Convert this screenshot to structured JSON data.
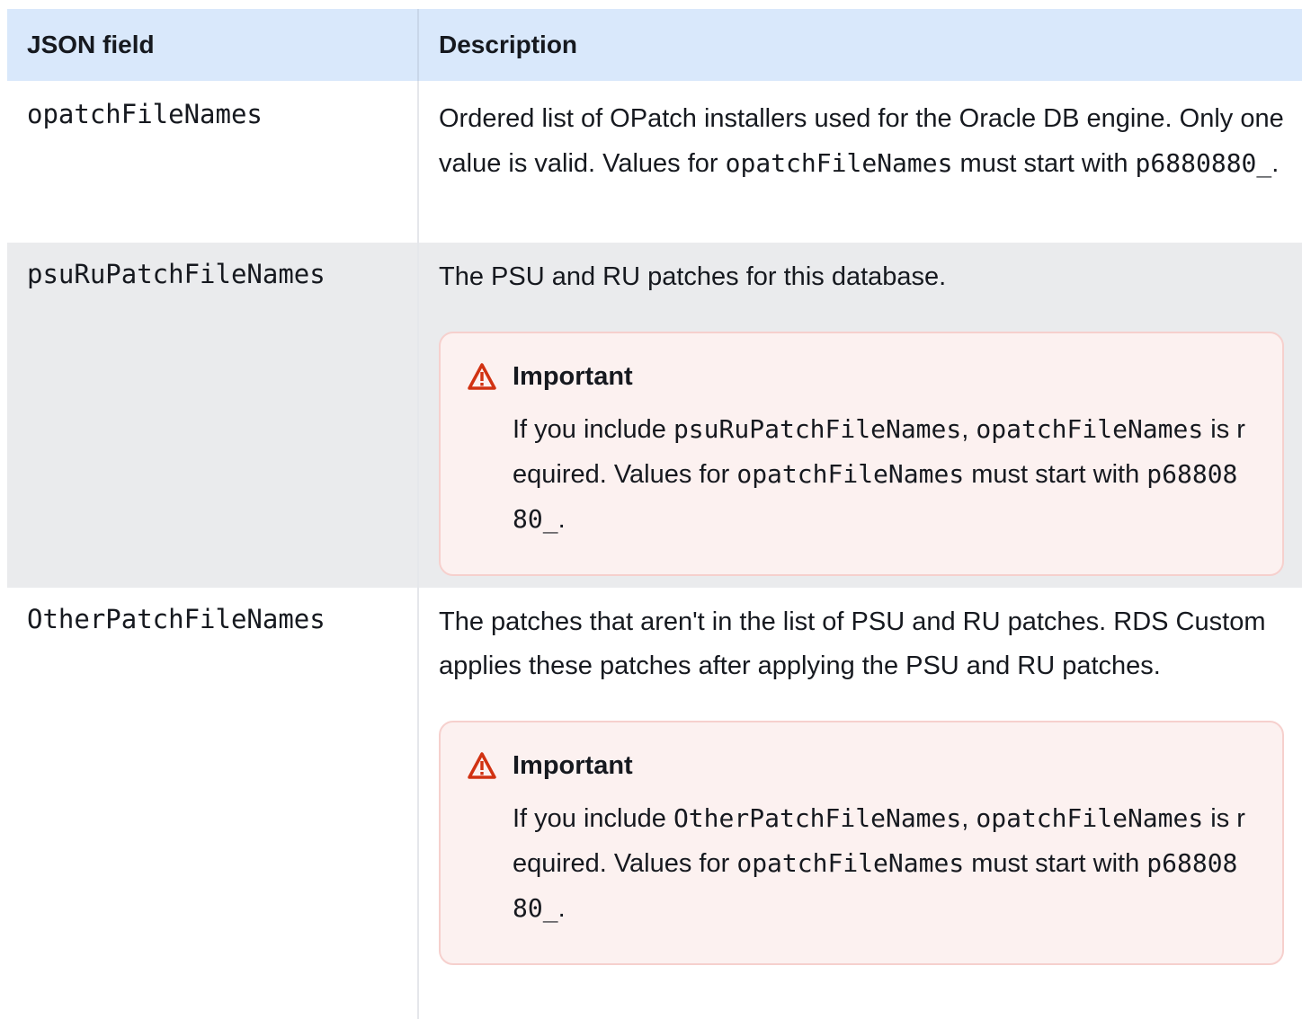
{
  "header": {
    "col_field": "JSON field",
    "col_desc": "Description"
  },
  "rows": [
    {
      "field": "opatchFileNames",
      "desc_part1": "Ordered list of OPatch installers used for the Oracle DB engine. Only one value is valid. Values for ",
      "desc_code1": "opatchFileNames",
      "desc_part2": " must start with ",
      "desc_code2": "p6880880_",
      "desc_part3": "."
    },
    {
      "field": "psuRuPatchFileNames",
      "desc": "The PSU and RU patches for this database.",
      "callout": {
        "title": "Important",
        "text1": "If you include ",
        "code1": "psuRuPatchFileNames",
        "text2": ", ",
        "code2": "opatchFileNames",
        "text3": " is required. Values for ",
        "code3": "opatchFileNames",
        "text4": " must start with ",
        "code4": "p6880880_",
        "text5": "."
      }
    },
    {
      "field": "OtherPatchFileNames",
      "desc": "The patches that aren't in the list of PSU and RU patches. RDS Custom applies these patches after applying the PSU and RU patches.",
      "callout": {
        "title": "Important",
        "text1": "If you include ",
        "code1": "OtherPatchFileNames",
        "text2": ", ",
        "code2": "opatchFileNames",
        "text3": " is required. Values for ",
        "code3": "opatchFileNames",
        "text4": " must start with ",
        "code4": "p6880880_",
        "text5": "."
      }
    }
  ],
  "colors": {
    "header_bg": "#d9e8fb",
    "alt_row_bg": "#eaebed",
    "callout_bg": "#fcf1f0",
    "callout_border": "#f6d0cd",
    "warning_icon": "#d13212"
  },
  "icons": {
    "callout_icon": "warning-triangle-icon"
  }
}
